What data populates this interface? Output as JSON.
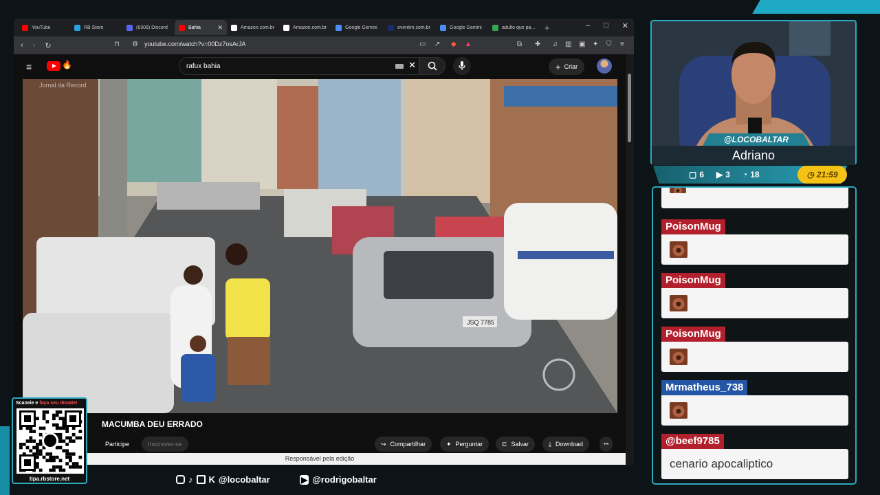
{
  "browser": {
    "tabs": [
      {
        "title": "YouTube",
        "color": "#ff0000"
      },
      {
        "title": "RB Store",
        "color": "#2aa1e0"
      },
      {
        "title": "(6309) Discord",
        "color": "#5865f2"
      },
      {
        "title": "Bahia",
        "color": "#ff0000"
      },
      {
        "title": "Amazon.com.br",
        "color": "#ffffff"
      },
      {
        "title": "Amazon.com.br",
        "color": "#ffffff"
      },
      {
        "title": "Google Gemini",
        "color": "#4c8df6"
      },
      {
        "title": "eventim.com.br",
        "color": "#1a2a6c"
      },
      {
        "title": "Google Gemini",
        "color": "#4c8df6"
      },
      {
        "title": "adulto que pa...",
        "color": "#34a853"
      }
    ],
    "new_tab": "+",
    "window_controls": [
      "–",
      "□",
      "✕"
    ],
    "url": "youtube.com/watch?v=00Dz7osArJA"
  },
  "youtube": {
    "search_value": "rafux bahia",
    "create_label": "Criar",
    "player_watermark": "Jornal da Record",
    "plate_text": "JSQ 7785",
    "video_title": "MACUMBA DEU ERRADO",
    "join_label": "Participe",
    "subscribe_label": "Inscrever-se",
    "share_label": "Compartilhar",
    "ask_label": "Perguntar",
    "save_label": "Salvar",
    "download_label": "Download",
    "more_label": "•••",
    "caption": "Responsável pela edição"
  },
  "stream": {
    "handle": "@LOCOBALTAR",
    "name": "Adriano",
    "stats": [
      "6",
      "3",
      "18"
    ],
    "timer": "21:59"
  },
  "chat": [
    {
      "user": "PoisonMug",
      "color": "#b3202d",
      "text": ""
    },
    {
      "user": "PoisonMug",
      "color": "#b3202d",
      "text": ""
    },
    {
      "user": "PoisonMug",
      "color": "#b3202d",
      "text": ""
    },
    {
      "user": "Mrmatheus_738",
      "color": "#2456a8",
      "text": ""
    },
    {
      "user": "@beef9785",
      "color": "#b3202d",
      "text": "cenario apocaliptico"
    }
  ],
  "overlay": {
    "qr_top_white": "Scaneie e",
    "qr_top_red": "faça seu donate!",
    "qr_url": "tipa.rbstore.net",
    "social_1": "@locobaltar",
    "social_2": "@rodrigobaltar"
  }
}
